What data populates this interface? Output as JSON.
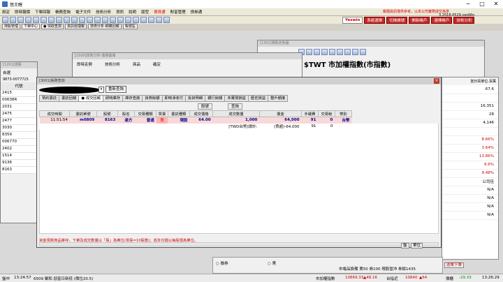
{
  "app": {
    "title": "怒王瞎"
  },
  "menu": [
    "設定",
    "即時報價",
    "下單回報",
    "帳務查詢",
    "電子文件",
    "技術分析",
    "資訊",
    "說明",
    "版型",
    "股票定期定額",
    "財富管理",
    "債資通",
    "債券通"
  ],
  "menu_red_index": 11,
  "notice": "報價資訊僅供參考，以本公司實際成交為準",
  "version": "3.2018.0529.yesWin",
  "right_buttons": {
    "logo": "Yeswin",
    "btn1": "系統選單",
    "btn2": "切換帳號",
    "btn3": "開新帳戶",
    "btn4": "選擇帳戶",
    "btn5": "技術分析"
  },
  "toolbar2": [
    "持股管理",
    "下單中心",
    "● 快取查詢",
    "資訊經理報",
    "技術分析-網路回報",
    "帳號區"
  ],
  "left_win": {
    "title": "[1201]證權",
    "tab": "自選",
    "acct": "9873-0077715",
    "header": "代號",
    "rows": [
      "2415",
      "00638R",
      "2031",
      "2475",
      "2477",
      "3030",
      "8359",
      "006770",
      "2402",
      "1514",
      "9136",
      "8163"
    ]
  },
  "right_col": {
    "label": "當日買單位.百萬",
    "values": [
      {
        "v": "67.6",
        "c": ""
      },
      {
        "v": "",
        "c": ""
      },
      {
        "v": "16,351",
        "c": ""
      },
      {
        "v": "28",
        "c": ""
      },
      {
        "v": "4,146",
        "c": ""
      },
      {
        "v": "",
        "c": ""
      },
      {
        "v": "8.66%",
        "c": "red"
      },
      {
        "v": "3.64%",
        "c": "red"
      },
      {
        "v": "13.86%",
        "c": "red"
      },
      {
        "v": "9.6%",
        "c": "red"
      },
      {
        "v": "9.48%",
        "c": "red"
      },
      {
        "v": "公司佳",
        "c": ""
      },
      {
        "v": "N/A",
        "c": ""
      },
      {
        "v": "N/A",
        "c": ""
      },
      {
        "v": "N/A",
        "c": ""
      },
      {
        "v": "N/A",
        "c": ""
      }
    ]
  },
  "wt_win": {
    "title": "[1301]場勢走勢圖",
    "heading": "$TWT 市加權指數(市指數)"
  },
  "mid_win": {
    "title": "[1500]技術分析-價量圖撮",
    "fields": [
      "即時走勢",
      "技術分析",
      "商品",
      "確定"
    ]
  },
  "main": {
    "title": "[3001]帳務查詢",
    "refresh": "重新查詢",
    "tabs": [
      "預約委託",
      "委託回報",
      "● 成交回報",
      "即時庫存",
      "庫存查詢",
      "資券餘額",
      "即時淨收付",
      "投資明細",
      "銀行餘額",
      "未實現損益",
      "歷史損益",
      "整戶額度"
    ],
    "active_tab": 2,
    "sub": [
      "股號",
      "查詢"
    ],
    "columns": [
      "成交時間",
      "委託單號",
      "股號",
      "股名",
      "交易種類",
      "買賣",
      "委託種類",
      "成交價格",
      "成交數量",
      "價金",
      "手續費",
      "交易稅",
      "幣別"
    ],
    "rows": [
      [
        "11:51:54",
        "m0809",
        "8163",
        "達方",
        "普通",
        "買",
        "現股",
        "64.00",
        "1,000",
        "64,000",
        "91",
        "0",
        "台幣"
      ],
      [
        "",
        "",
        "",
        "",
        "",
        "",
        "",
        "",
        "[TWD台幣]總計:",
        "(買超)-64,000",
        "91",
        "0",
        ""
      ]
    ],
    "footnote": "資金現貨商品庫存，下單及成交數量以「股」為單位(零股=10股數)；成本均價以每股價為單位。"
  },
  "trade_win": {
    "b1": "盤",
    "b2": "單位",
    "go": "送單下單"
  },
  "bottom_win": {
    "r1": "融券",
    "r2": "賣",
    "text": "市電品設備 賣50 券100 現股當沖 券餘1435"
  },
  "status": {
    "left": "盤中",
    "time": "13:24:57",
    "info": "6509 聚和 創富日新低 (價位20.5)",
    "idx_label": "市加權指數",
    "idx": "10869.33",
    "idx_chg": "▲48.16",
    "otc_label": "台指近",
    "otc": "10840",
    "otc_chg": "▲64",
    "bond_label": "價櫃",
    "bond_chg": "-29.33",
    "clock": "13:26:29"
  }
}
